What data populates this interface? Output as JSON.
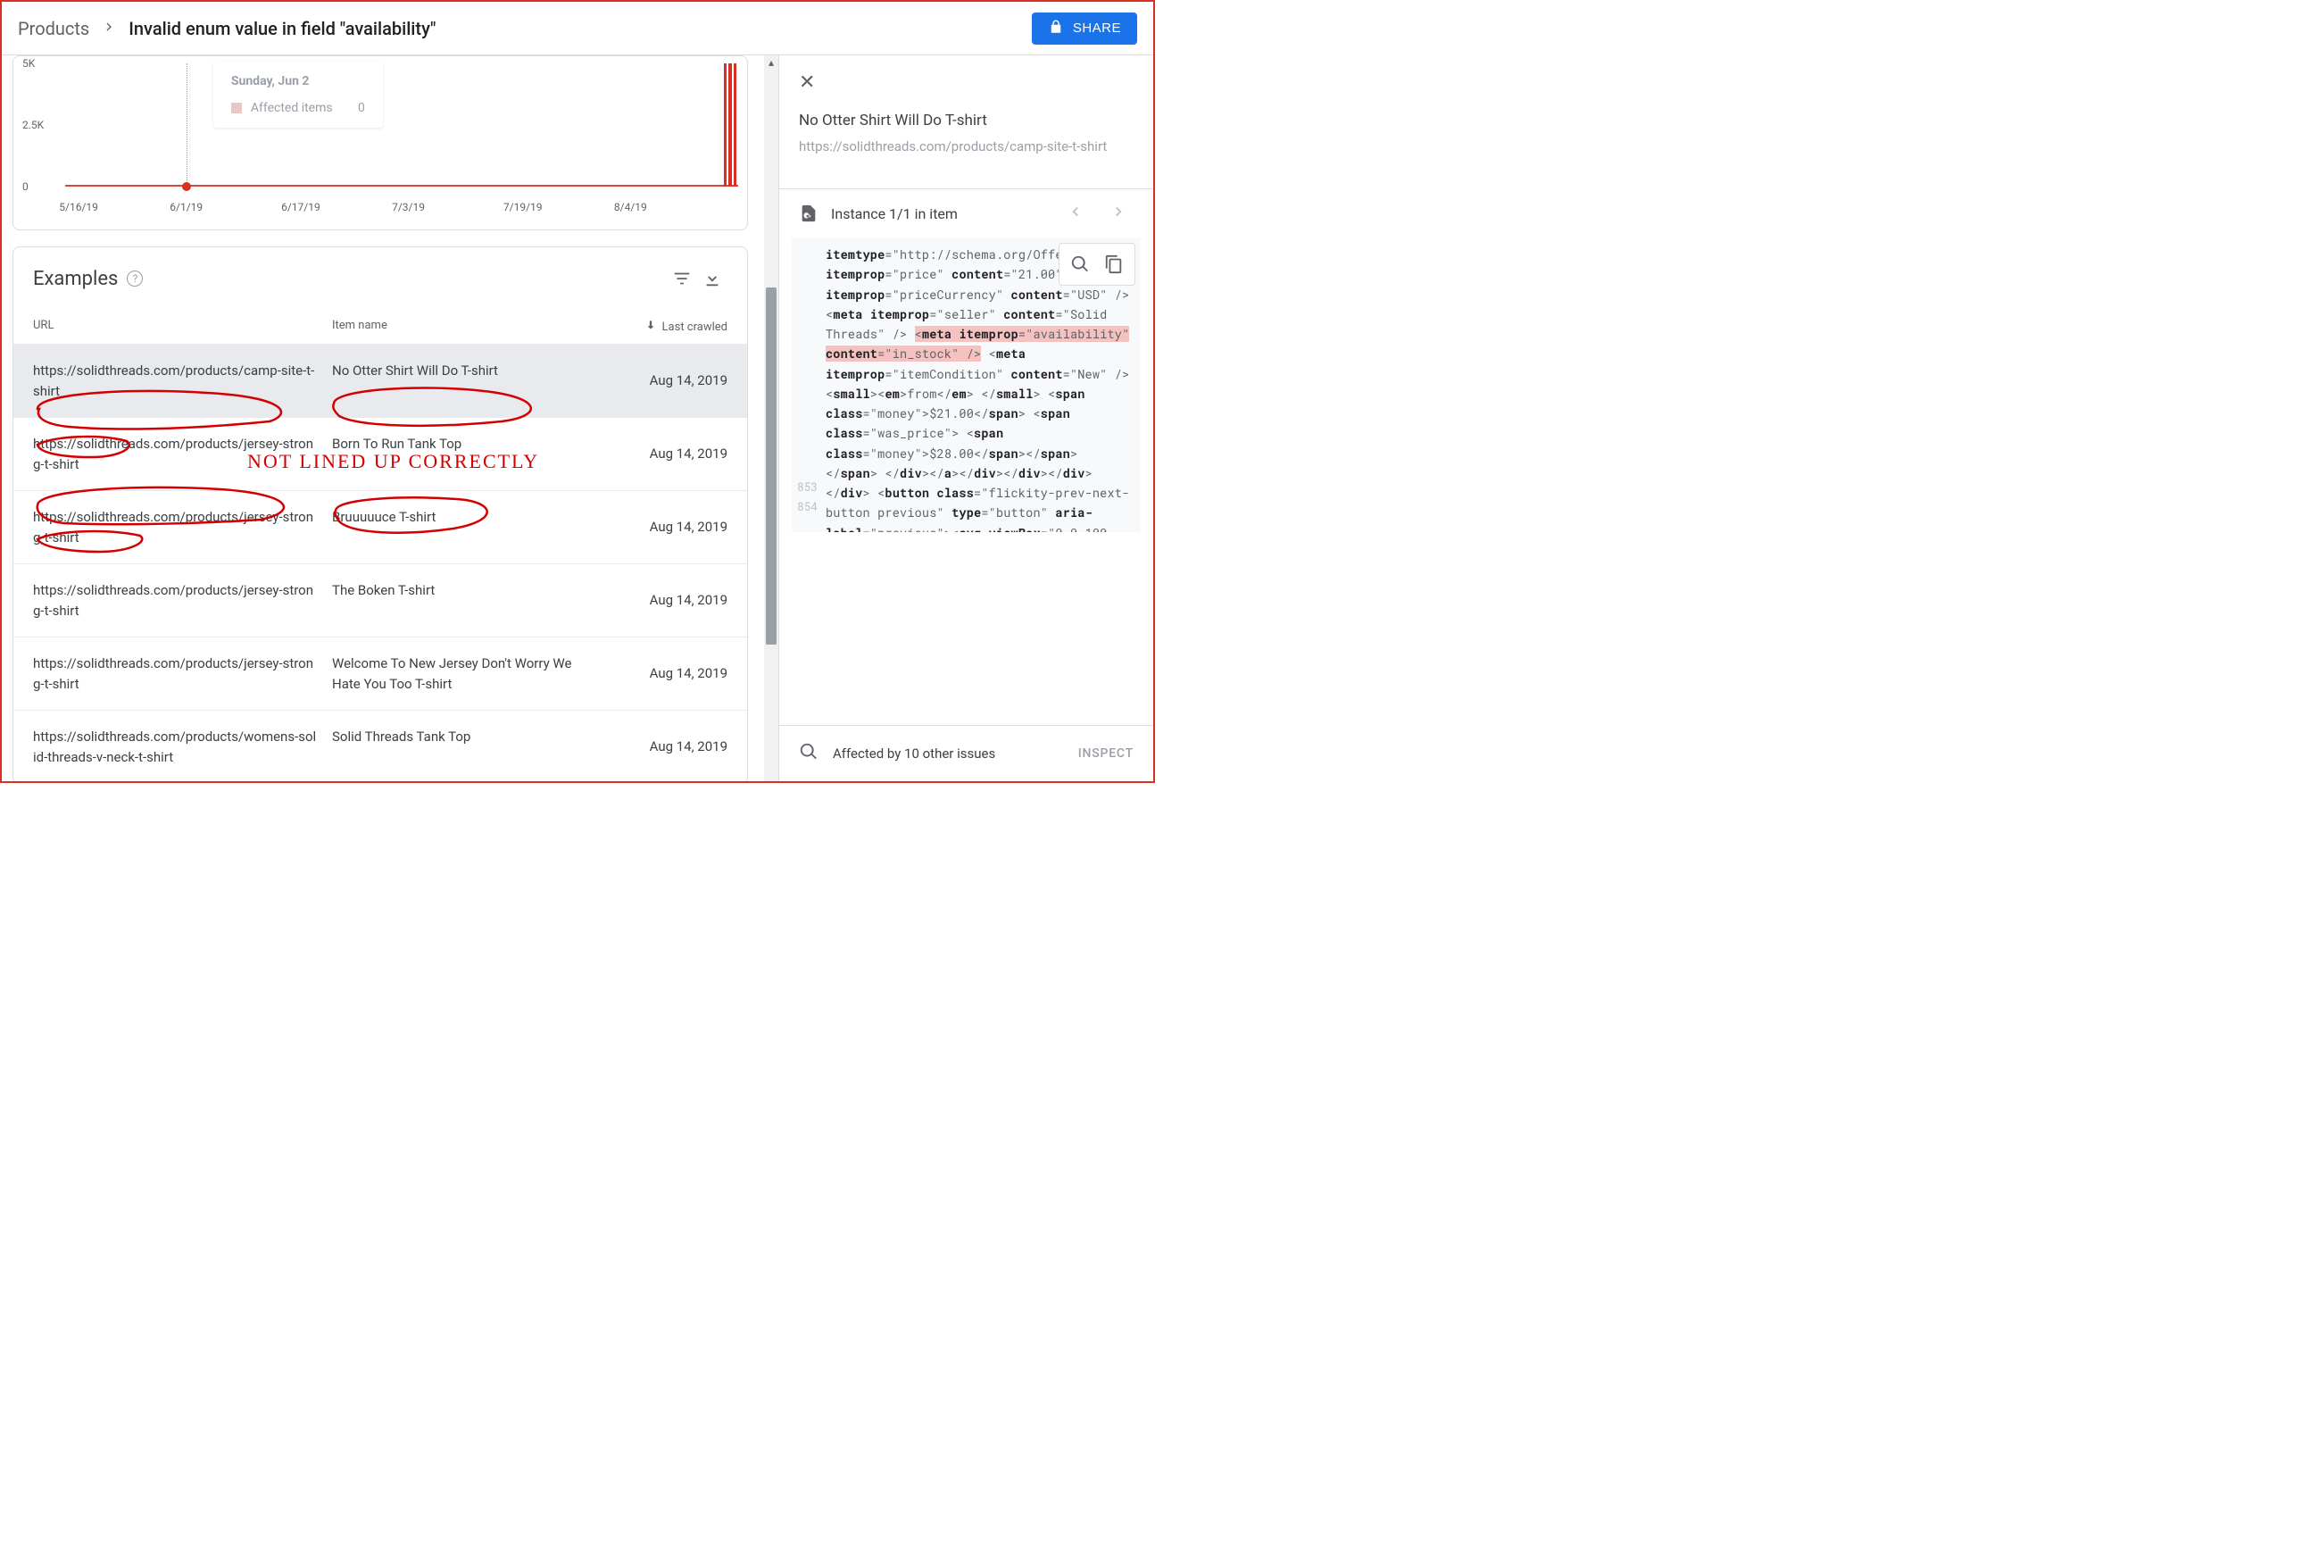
{
  "header": {
    "breadcrumb_root": "Products",
    "breadcrumb_leaf": "Invalid enum value in field \"availability\"",
    "share_label": "SHARE"
  },
  "chart_data": {
    "type": "bar",
    "title": "",
    "xlabel": "",
    "ylabel": "",
    "yticks": [
      "5K",
      "2.5K",
      "0"
    ],
    "xticks": [
      "5/16/19",
      "6/1/19",
      "6/17/19",
      "7/3/19",
      "7/19/19",
      "8/4/19"
    ],
    "ylim": [
      0,
      5000
    ],
    "series": [
      {
        "name": "Affected items",
        "x_dates": [
          "8/14/19"
        ],
        "values": [
          5000
        ]
      }
    ],
    "hover": {
      "date_label": "Sunday, Jun 2",
      "metric": "Affected items",
      "value": "0",
      "x_tick": "6/1/19"
    }
  },
  "examples": {
    "title": "Examples",
    "columns": {
      "url": "URL",
      "item": "Item name",
      "date": "Last crawled"
    },
    "rows": [
      {
        "url": "https://solidthreads.com/products/camp-site-t-shirt",
        "item": "No Otter Shirt Will Do T-shirt",
        "date": "Aug 14, 2019",
        "selected": true
      },
      {
        "url": "https://solidthreads.com/products/jersey-strong-t-shirt",
        "item": "Born To Run Tank Top",
        "date": "Aug 14, 2019"
      },
      {
        "url": "https://solidthreads.com/products/jersey-strong-t-shirt",
        "item": "Bruuuuuce T-shirt",
        "date": "Aug 14, 2019"
      },
      {
        "url": "https://solidthreads.com/products/jersey-strong-t-shirt",
        "item": "The Boken T-shirt",
        "date": "Aug 14, 2019"
      },
      {
        "url": "https://solidthreads.com/products/jersey-strong-t-shirt",
        "item": "Welcome To New Jersey Don't Worry We Hate You Too T-shirt",
        "date": "Aug 14, 2019"
      },
      {
        "url": "https://solidthreads.com/products/womens-solid-threads-v-neck-t-shirt",
        "item": "Solid Threads Tank Top",
        "date": "Aug 14, 2019"
      }
    ]
  },
  "detail": {
    "title": "No Otter Shirt Will Do T-shirt",
    "url": "https://solidthreads.com/products/camp-site-t-shirt",
    "instance_label": "Instance 1/1 in item",
    "line_no_a": "853",
    "line_no_b": "854",
    "footer_text": "Affected by 10 other issues",
    "inspect_label": "INSPECT"
  },
  "annotation": {
    "text": "NOT LINED UP CORRECTLY"
  }
}
